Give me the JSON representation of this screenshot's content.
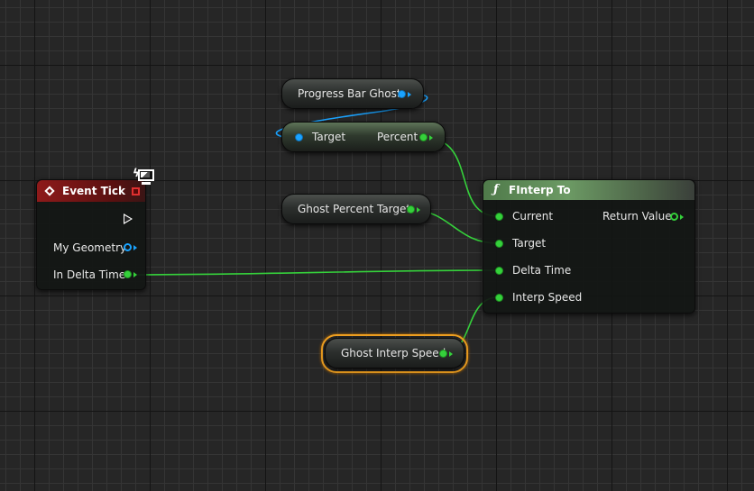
{
  "colors": {
    "grid_bg": "#262626",
    "exec_header": "#7a1414",
    "function_header": "#4e7a4a",
    "float_pin": "#35d13b",
    "object_pin": "#1aa3ff",
    "selection": "#f0a020"
  },
  "nodes": {
    "event_tick": {
      "title": "Event Tick",
      "pins": [
        "My Geometry",
        "In Delta Time"
      ]
    },
    "progress_bar_ghost": {
      "label": "Progress Bar Ghost"
    },
    "percent_getter": {
      "target_label": "Target",
      "output_label": "Percent"
    },
    "ghost_percent_target": {
      "label": "Ghost Percent Target"
    },
    "ghost_interp_speed": {
      "label": "Ghost Interp Speed"
    },
    "finterp_to": {
      "title": "FInterp To",
      "inputs": [
        "Current",
        "Target",
        "Delta Time",
        "Interp Speed"
      ],
      "output": "Return Value"
    }
  }
}
